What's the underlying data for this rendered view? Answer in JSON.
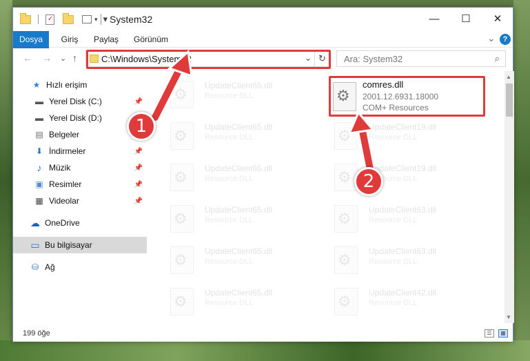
{
  "window": {
    "title": "System32",
    "minimize": "—",
    "maximize": "☐",
    "close": "✕"
  },
  "ribbon": {
    "tabs": [
      "Dosya",
      "Giriş",
      "Paylaş",
      "Görünüm"
    ],
    "collapse": "⌄",
    "help": "?"
  },
  "nav": {
    "back": "←",
    "forward": "→",
    "recent": "⌄",
    "up": "↑",
    "address": "C:\\Windows\\System32",
    "address_chevron": "⌄",
    "refresh": "↻",
    "search_placeholder": "Ara: System32",
    "search_icon": "⌕"
  },
  "sidebar": {
    "items": [
      {
        "label": "Hızlı erişim",
        "icon": "star-icon",
        "glyph": "★",
        "color": "#3a7fd5"
      },
      {
        "label": "Yerel Disk (C:)",
        "icon": "drive-icon",
        "glyph": "▬",
        "color": "#555555",
        "pinned": true
      },
      {
        "label": "Yerel Disk (D:)",
        "icon": "drive-icon",
        "glyph": "▬",
        "color": "#555555",
        "pinned": true
      },
      {
        "label": "Belgeler",
        "icon": "document-icon",
        "glyph": "▤",
        "color": "#6a6a6a",
        "pinned": true
      },
      {
        "label": "İndirmeler",
        "icon": "download-icon",
        "glyph": "⬇",
        "color": "#2d73c8",
        "pinned": true
      },
      {
        "label": "Müzik",
        "icon": "music-icon",
        "glyph": "♪",
        "color": "#2d73c8",
        "pinned": true
      },
      {
        "label": "Resimler",
        "icon": "pictures-icon",
        "glyph": "▣",
        "color": "#4f8ac9",
        "pinned": true
      },
      {
        "label": "Videolar",
        "icon": "video-icon",
        "glyph": "▦",
        "color": "#444444",
        "pinned": true
      },
      {
        "label": "OneDrive",
        "icon": "cloud-icon",
        "glyph": "☁",
        "color": "#1f5fb8"
      },
      {
        "label": "Bu bilgisayar",
        "icon": "computer-icon",
        "glyph": "▭",
        "color": "#2d73c8",
        "selected": true
      },
      {
        "label": "Ağ",
        "icon": "network-icon",
        "glyph": "⛁",
        "color": "#2d73c8"
      }
    ],
    "pin_glyph": "📌"
  },
  "files": {
    "left_column": [
      {
        "name": "UpdateClient65.dll",
        "type": "Resource DLL"
      },
      {
        "name": "UpdateClient65.dll",
        "type": "Resource DLL"
      },
      {
        "name": "UpdateClient65.dll",
        "type": "Resource DLL"
      },
      {
        "name": "UpdateClient65.dll",
        "type": "Resource DLL"
      },
      {
        "name": "UpdateClient65.dll",
        "type": "Resource DLL"
      },
      {
        "name": "UpdateClient65.dll",
        "type": "Resource DLL"
      }
    ],
    "right_column": [
      {
        "name": "UpdateClient19.dll",
        "type": "Resource DLL"
      },
      {
        "name": "UpdateClient19.dll",
        "type": "Resource DLL"
      },
      {
        "name": "UpdateClient63.dll",
        "type": "Resource DLL"
      },
      {
        "name": "UpdateClient63.dll",
        "type": "Resource DLL"
      },
      {
        "name": "UpdateClient42.dll",
        "type": "Resource DLL"
      }
    ],
    "selected": {
      "name": "comres.dll",
      "version": "2001.12.6931.18000",
      "description": "COM+ Resources"
    }
  },
  "status": {
    "count": "199 öğe",
    "details_view": "☰",
    "icons_view": "▦"
  },
  "callouts": [
    "1",
    "2"
  ],
  "colors": {
    "accent": "#1979ca",
    "highlight": "#e03a3a"
  }
}
